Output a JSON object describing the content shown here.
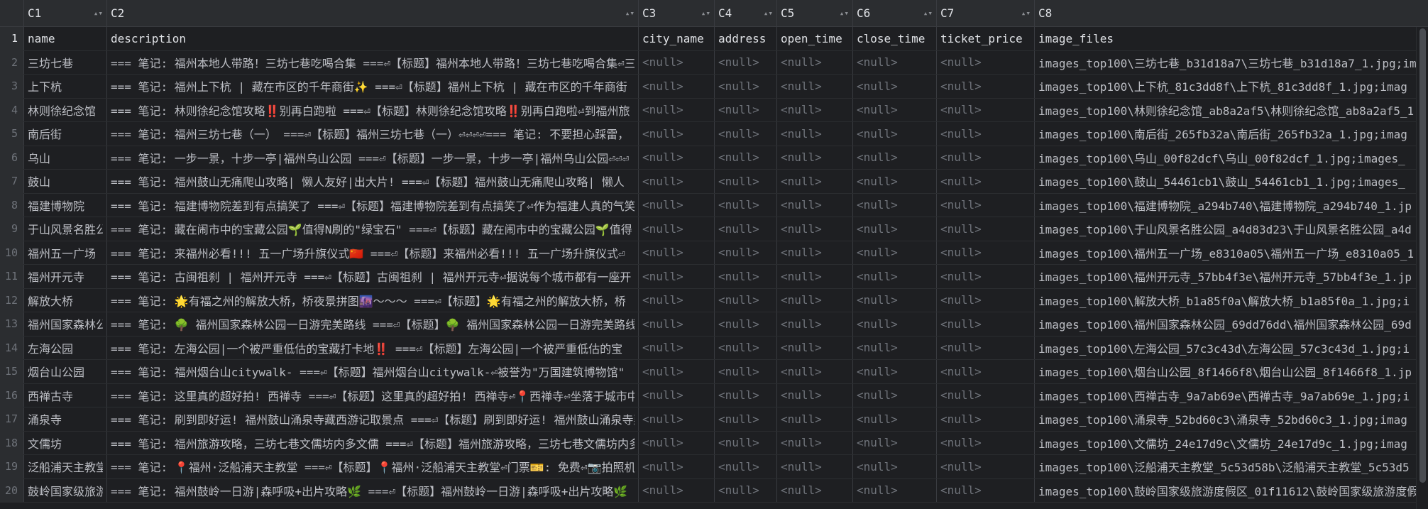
{
  "columns": [
    "C1",
    "C2",
    "C3",
    "C4",
    "C5",
    "C6",
    "C7",
    "C8"
  ],
  "fields": [
    "name",
    "description",
    "city_name",
    "address",
    "open_time",
    "close_time",
    "ticket_price",
    "image_files"
  ],
  "null_label": "<null>",
  "rows": [
    {
      "num": "2",
      "name": "三坊七巷",
      "description": "=== 笔记: 福州本地人带路！三坊七巷吃喝合集 ===⏎【标题】福州本地人带路！三坊七巷吃喝合集⏎三",
      "image_files": "images_top100\\三坊七巷_b31d18a7\\三坊七巷_b31d18a7_1.jpg;im"
    },
    {
      "num": "3",
      "name": "上下杭",
      "description": "=== 笔记: 福州上下杭 | 藏在市区的千年商街✨ ===⏎【标题】福州上下杭 | 藏在市区的千年商街",
      "image_files": "images_top100\\上下杭_81c3dd8f\\上下杭_81c3dd8f_1.jpg;imag"
    },
    {
      "num": "4",
      "name": "林则徐纪念馆",
      "description": "=== 笔记: 林则徐纪念馆攻略‼️别再白跑啦 ===⏎【标题】林则徐纪念馆攻略‼️别再白跑啦⏎到福州旅",
      "image_files": "images_top100\\林则徐纪念馆_ab8a2af5\\林则徐纪念馆_ab8a2af5_1"
    },
    {
      "num": "5",
      "name": "南后街",
      "description": "=== 笔记: 福州三坊七巷（一） ===⏎【标题】福州三坊七巷（一）⏎⏎⏎⏎=== 笔记: 不要担心踩雷，",
      "image_files": "images_top100\\南后街_265fb32a\\南后街_265fb32a_1.jpg;imag"
    },
    {
      "num": "6",
      "name": "乌山",
      "description": "=== 笔记: 一步一景，十步一亭|福州乌山公园 ===⏎【标题】一步一景，十步一亭|福州乌山公园⏎⏎⏎",
      "image_files": "images_top100\\乌山_00f82dcf\\乌山_00f82dcf_1.jpg;images_"
    },
    {
      "num": "7",
      "name": "鼓山",
      "description": "=== 笔记: 福州鼓山无痛爬山攻略| 懒人友好|出大片! ===⏎【标题】福州鼓山无痛爬山攻略| 懒人",
      "image_files": "images_top100\\鼓山_54461cb1\\鼓山_54461cb1_1.jpg;images_"
    },
    {
      "num": "8",
      "name": "福建博物院",
      "description": "=== 笔记: 福建博物院差到有点搞笑了 ===⏎【标题】福建博物院差到有点搞笑了⏎作为福建人真的气笑",
      "image_files": "images_top100\\福建博物院_a294b740\\福建博物院_a294b740_1.jp"
    },
    {
      "num": "9",
      "name": "于山风景名胜公园",
      "description": "=== 笔记: 藏在闹市中的宝藏公园🌱值得N刷的\"绿宝石\" ===⏎【标题】藏在闹市中的宝藏公园🌱值得",
      "image_files": "images_top100\\于山风景名胜公园_a4d83d23\\于山风景名胜公园_a4d"
    },
    {
      "num": "10",
      "name": "福州五一广场",
      "description": "=== 笔记: 来福州必看!!! 五一广场升旗仪式🇨🇳 ===⏎【标题】来福州必看!!! 五一广场升旗仪式⏎",
      "image_files": "images_top100\\福州五一广场_e8310a05\\福州五一广场_e8310a05_1"
    },
    {
      "num": "11",
      "name": "福州开元寺",
      "description": "=== 笔记: 古闽祖刹 | 福州开元寺 ===⏎【标题】古闽祖刹 | 福州开元寺⏎据说每个城市都有一座开",
      "image_files": "images_top100\\福州开元寺_57bb4f3e\\福州开元寺_57bb4f3e_1.jp"
    },
    {
      "num": "12",
      "name": "解放大桥",
      "description": "=== 笔记: 🌟有福之州的解放大桥，桥夜景拼图🌆～～～ ===⏎【标题】🌟有福之州的解放大桥，桥",
      "image_files": "images_top100\\解放大桥_b1a85f0a\\解放大桥_b1a85f0a_1.jpg;i"
    },
    {
      "num": "13",
      "name": "福州国家森林公园",
      "description": "=== 笔记: 🌳 福州国家森林公园一日游完美路线 ===⏎【标题】🌳 福州国家森林公园一日游完美路线",
      "image_files": "images_top100\\福州国家森林公园_69dd76dd\\福州国家森林公园_69d"
    },
    {
      "num": "14",
      "name": "左海公园",
      "description": "=== 笔记: 左海公园|一个被严重低估的宝藏打卡地‼️ ===⏎【标题】左海公园|一个被严重低估的宝",
      "image_files": "images_top100\\左海公园_57c3c43d\\左海公园_57c3c43d_1.jpg;i"
    },
    {
      "num": "15",
      "name": "烟台山公园",
      "description": "=== 笔记: 福州烟台山citywalk- ===⏎【标题】福州烟台山citywalk-⏎被誉为\"万国建筑博物馆\"",
      "image_files": "images_top100\\烟台山公园_8f1466f8\\烟台山公园_8f1466f8_1.jp"
    },
    {
      "num": "16",
      "name": "西禅古寺",
      "description": "=== 笔记: 这里真的超好拍! 西禅寺 ===⏎【标题】这里真的超好拍! 西禅寺⏎📍西禅寺⏎坐落于城市中",
      "image_files": "images_top100\\西禅古寺_9a7ab69e\\西禅古寺_9a7ab69e_1.jpg;i"
    },
    {
      "num": "17",
      "name": "涌泉寺",
      "description": "=== 笔记: 刷到即好运! 福州鼓山涌泉寺藏西游记取景点 ===⏎【标题】刷到即好运! 福州鼓山涌泉寺藏",
      "image_files": "images_top100\\涌泉寺_52bd60c3\\涌泉寺_52bd60c3_1.jpg;imag"
    },
    {
      "num": "18",
      "name": "文儒坊",
      "description": "=== 笔记: 福州旅游攻略，三坊七巷文儒坊内多文儒 ===⏎【标题】福州旅游攻略，三坊七巷文儒坊内多",
      "image_files": "images_top100\\文儒坊_24e17d9c\\文儒坊_24e17d9c_1.jpg;imag"
    },
    {
      "num": "19",
      "name": "泛船浦天主教堂",
      "description": "=== 笔记: 📍福州·泛船浦天主教堂 ===⏎【标题】📍福州·泛船浦天主教堂⏎门票🎫: 免费⏎📷拍照机",
      "image_files": "images_top100\\泛船浦天主教堂_5c53d58b\\泛船浦天主教堂_5c53d5"
    },
    {
      "num": "20",
      "name": "鼓岭国家级旅游度假区",
      "description": "=== 笔记: 福州鼓岭一日游|森呼吸+出片攻略🌿 ===⏎【标题】福州鼓岭一日游|森呼吸+出片攻略🌿",
      "image_files": "images_top100\\鼓岭国家级旅游度假区_01f11612\\鼓岭国家级旅游度假"
    }
  ]
}
